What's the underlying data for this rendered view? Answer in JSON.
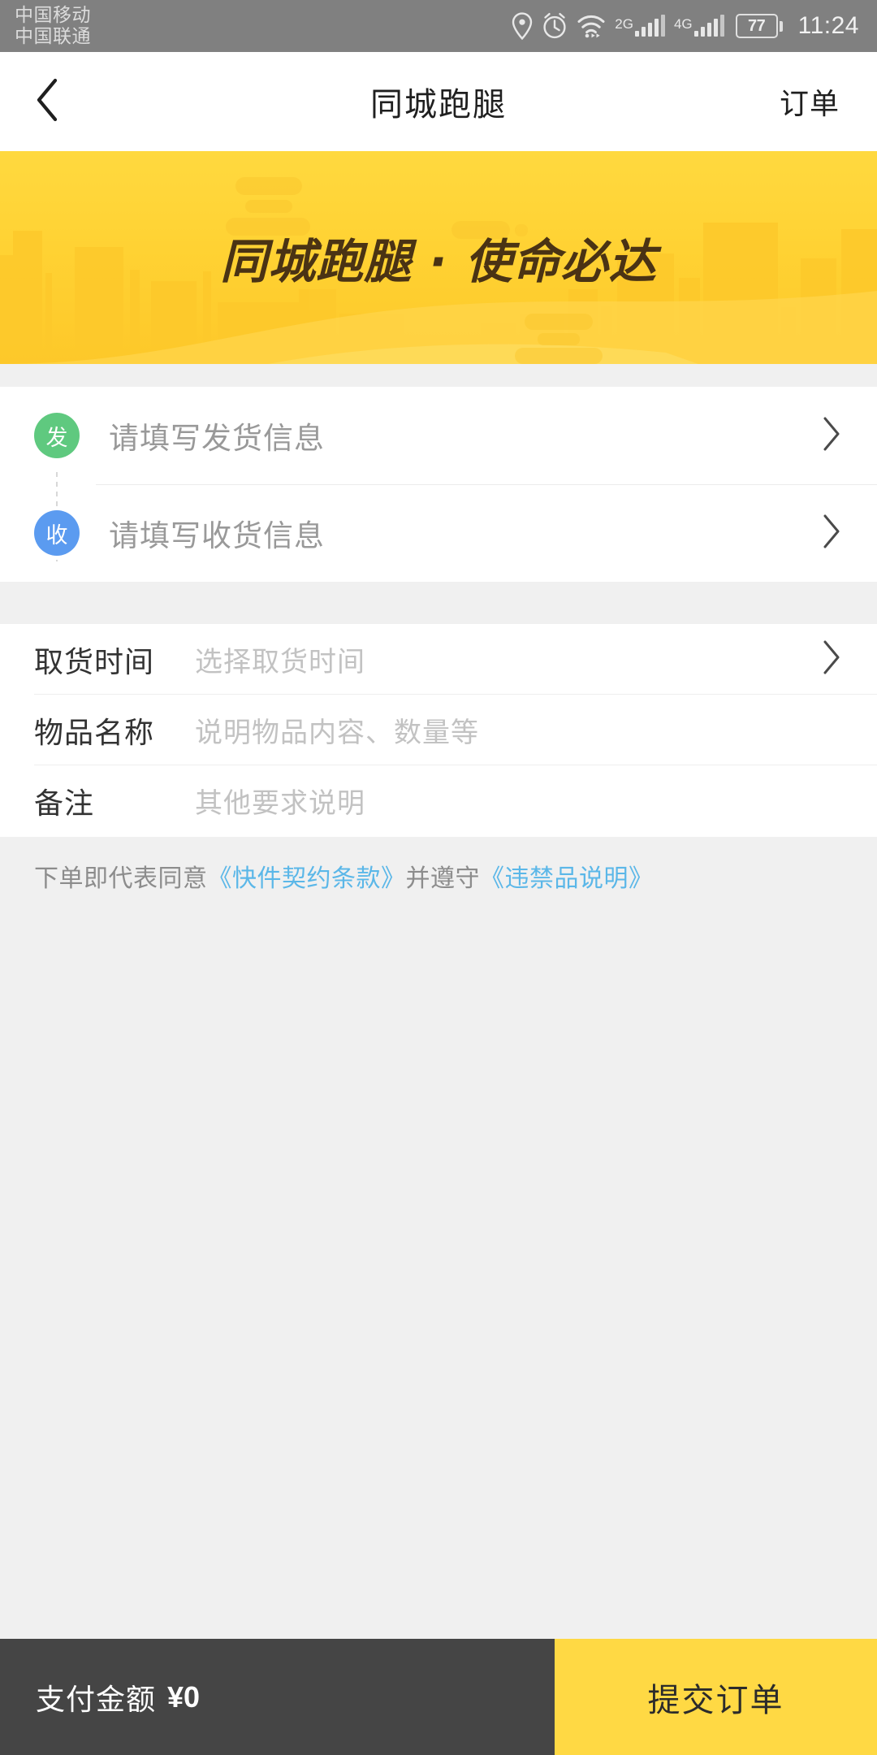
{
  "statusbar": {
    "carrier_primary": "中国移动",
    "carrier_secondary": "中国联通",
    "network_2g_label": "2G",
    "network_4g_label": "4G",
    "battery_percent": "77",
    "time": "11:24",
    "icons": [
      "location-pin-icon",
      "alarm-clock-icon",
      "wifi-icon",
      "signal-2g-icon",
      "signal-4g-icon",
      "battery-icon"
    ]
  },
  "navbar": {
    "back_icon": "chevron-left-icon",
    "title": "同城跑腿",
    "action_label": "订单"
  },
  "banner": {
    "headline": "同城跑腿 · 使命必达",
    "bg_color_top": "#FFD93F",
    "bg_color_bottom": "#FDC829",
    "text_color": "#4A3314"
  },
  "address": {
    "sender": {
      "badge": "发",
      "badge_color": "#5FC97F",
      "placeholder": "请填写发货信息",
      "chevron": "chevron-right-icon"
    },
    "receiver": {
      "badge": "收",
      "badge_color": "#5B9BF0",
      "placeholder": "请填写收货信息",
      "chevron": "chevron-right-icon"
    }
  },
  "form": {
    "rows": [
      {
        "label": "取货时间",
        "value": "选择取货时间",
        "has_chevron": true
      },
      {
        "label": "物品名称",
        "value": "说明物品内容、数量等",
        "has_chevron": false
      },
      {
        "label": "备注",
        "value": "其他要求说明",
        "has_chevron": false
      }
    ]
  },
  "terms": {
    "prefix": "下单即代表同意",
    "link1": "《快件契约条款》",
    "middle": "并遵守",
    "link2": "《违禁品说明》",
    "link_color": "#5BB7E8"
  },
  "bottombar": {
    "pay_label": "支付金额",
    "pay_amount": "¥0",
    "submit_label": "提交订单",
    "submit_color": "#FFD944",
    "pay_bg_color": "#454545"
  }
}
